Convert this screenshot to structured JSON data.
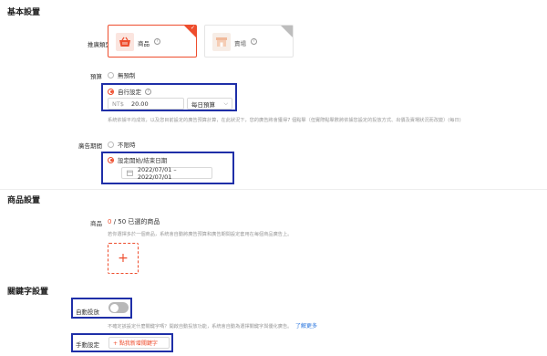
{
  "basic": {
    "title": "基本設置",
    "ad_type_label": "推廣類型",
    "type_product_label": "商品",
    "type_shop_label": "賣場",
    "budget_label": "預算",
    "budget_unlimited": "無預制",
    "budget_custom": "自行設定",
    "budget_currency": "NT$",
    "budget_value": "20.00",
    "budget_period": "每日預算",
    "budget_hint": "系統依據平均成效，以及您目前設定的廣告預算計算，在此狀況下，您的廣告將會獲得7 個點擊（但實際點擊數將依據您設定的投放方式、出價及賣場狀況而改變）(每日)",
    "period_label": "廣告期間",
    "period_unlimited": "不限時",
    "period_custom": "設定開始/結束日期",
    "date_range": "2022/07/01 – 2022/07/01"
  },
  "product": {
    "title": "商品設置",
    "products_label": "商品",
    "count_selected": "0",
    "count_rest": " / 50 已選的商品",
    "hint": "若你選擇多於一個商品，系統會自動將廣告預算和廣告期間設定套用在每個商品廣告上。",
    "add_symbol": "+"
  },
  "keyword": {
    "title": "關鍵字設置",
    "auto_label": "自動投放",
    "auto_hint": "不確定該設定什麼關鍵字嗎？開啟自動投放功能，系統會自動為選擇關鍵字與優化廣告。",
    "learn_more": "了解更多",
    "manual_label": "手動設定",
    "add_keyword": "+ 點我新增關鍵字"
  },
  "colors": {
    "accent": "#ee4d2d",
    "highlight": "#1f2fa8",
    "link": "#2673dd"
  },
  "icons": {
    "product": "shopping-basket-icon",
    "shop": "storefront-icon",
    "help": "question-circle-icon",
    "calendar": "calendar-icon",
    "dropdown": "chevron-down-icon",
    "check": "check-icon"
  }
}
